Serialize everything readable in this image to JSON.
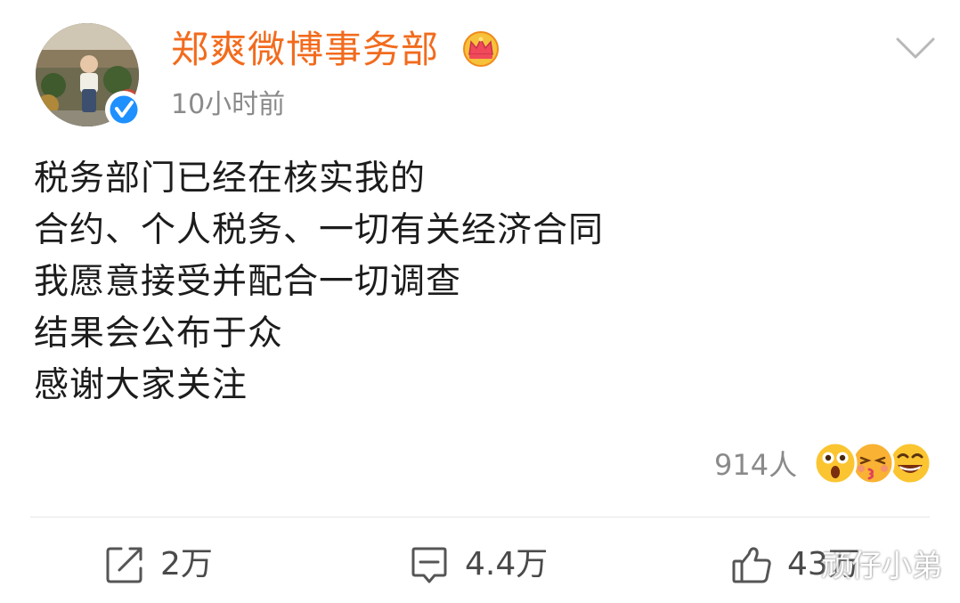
{
  "post": {
    "author": {
      "name": "郑爽微博事务部",
      "avatar_icon": "avatar-photo",
      "verified_icon": "verified-badge-icon",
      "vip_icon": "vip-crown-icon"
    },
    "timestamp": "10小时前",
    "body_lines": [
      "税务部门已经在核实我的",
      "合约、个人税务、一切有关经济合同",
      "我愿意接受并配合一切调查",
      "结果会公布于众",
      "感谢大家关注"
    ],
    "reactions": {
      "count": "914人",
      "emojis": [
        "shocked-face-icon",
        "kiss-face-icon",
        "grin-face-icon"
      ]
    },
    "actions": {
      "repost": {
        "icon": "repost-icon",
        "count": "2万"
      },
      "comment": {
        "icon": "comment-icon",
        "count": "4.4万"
      },
      "like": {
        "icon": "thumbs-up-icon",
        "count": "43万"
      }
    }
  },
  "watermark": "顽仔小弟",
  "colors": {
    "username": "#f26b1d",
    "meta_gray": "#8a8a8a",
    "verified_blue": "#1e90ff",
    "divider": "#e6e6e6"
  }
}
